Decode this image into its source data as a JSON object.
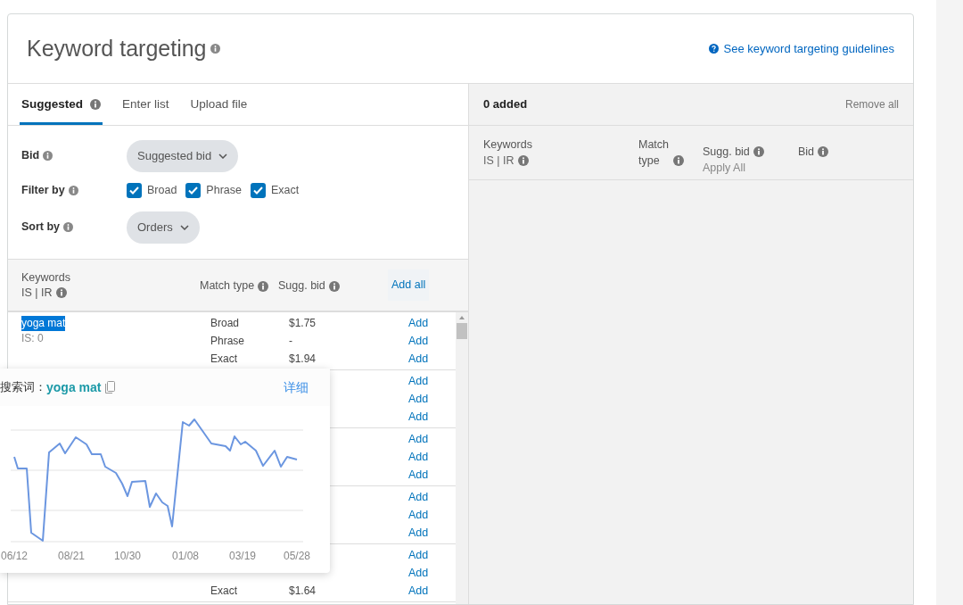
{
  "header": {
    "title": "Keyword targeting",
    "guidelines_link": "See keyword targeting guidelines"
  },
  "tabs": [
    {
      "label": "Suggested",
      "info": true,
      "selected": true
    },
    {
      "label": "Enter list",
      "info": false,
      "selected": false
    },
    {
      "label": "Upload file",
      "info": false,
      "selected": false
    }
  ],
  "filters": {
    "bid": {
      "label": "Bid",
      "value": "Suggested bid"
    },
    "filter_by": {
      "label": "Filter by",
      "options": [
        {
          "label": "Broad",
          "checked": true
        },
        {
          "label": "Phrase",
          "checked": true
        },
        {
          "label": "Exact",
          "checked": true
        }
      ]
    },
    "sort_by": {
      "label": "Sort by",
      "value": "Orders"
    }
  },
  "suggested_table": {
    "columns": [
      {
        "label": "Keywords",
        "sublabel": "IS | IR"
      },
      {
        "label": "Match type"
      },
      {
        "label": "Sugg. bid"
      }
    ],
    "add_all": "Add all",
    "groups": [
      {
        "keyword": "yoga mat",
        "highlighted": true,
        "is": "IS: 0",
        "rows": [
          {
            "match_type": "Broad",
            "bid": "$1.75",
            "action": "Add"
          },
          {
            "match_type": "Phrase",
            "bid": "-",
            "action": "Add"
          },
          {
            "match_type": "Exact",
            "bid": "$1.94",
            "action": "Add"
          }
        ]
      },
      {
        "rows": [
          {
            "action": "Add"
          },
          {
            "action": "Add"
          },
          {
            "action": "Add"
          }
        ]
      },
      {
        "rows": [
          {
            "action": "Add"
          },
          {
            "action": "Add"
          },
          {
            "action": "Add"
          }
        ]
      },
      {
        "rows": [
          {
            "action": "Add"
          },
          {
            "action": "Add"
          },
          {
            "action": "Add"
          }
        ]
      },
      {
        "rows": [
          {
            "action": "Add"
          },
          {
            "action": "Add"
          },
          {
            "match_type": "Exact",
            "bid": "$1.64",
            "action": "Add"
          }
        ]
      }
    ]
  },
  "added_panel": {
    "count": "0 added",
    "remove_all": "Remove all",
    "columns": [
      {
        "label": "Keywords",
        "sublabel": "IS | IR"
      },
      {
        "label": "Match type"
      },
      {
        "label": "Sugg. bid",
        "sublabel": "Apply All"
      },
      {
        "label": "Bid"
      }
    ]
  },
  "trend_popup": {
    "label": "搜索词：",
    "keyword": "yoga mat",
    "details_link": "详细",
    "x_labels": [
      "06/12",
      "08/21",
      "10/30",
      "01/08",
      "03/19",
      "05/28"
    ]
  }
}
